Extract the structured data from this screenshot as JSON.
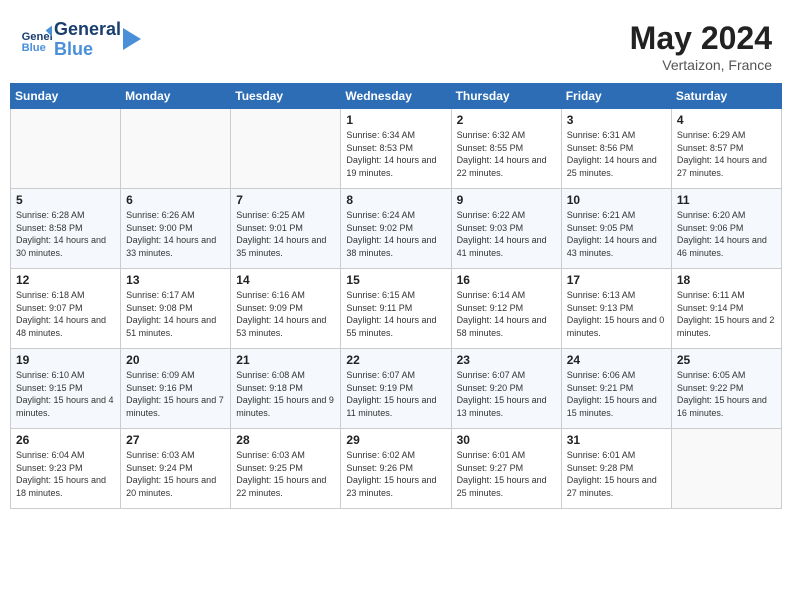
{
  "header": {
    "logo_line1": "General",
    "logo_line2": "Blue",
    "month_year": "May 2024",
    "location": "Vertaizon, France"
  },
  "days_of_week": [
    "Sunday",
    "Monday",
    "Tuesday",
    "Wednesday",
    "Thursday",
    "Friday",
    "Saturday"
  ],
  "weeks": [
    [
      {
        "day": "",
        "sunrise": "",
        "sunset": "",
        "daylight": ""
      },
      {
        "day": "",
        "sunrise": "",
        "sunset": "",
        "daylight": ""
      },
      {
        "day": "",
        "sunrise": "",
        "sunset": "",
        "daylight": ""
      },
      {
        "day": "1",
        "sunrise": "Sunrise: 6:34 AM",
        "sunset": "Sunset: 8:53 PM",
        "daylight": "Daylight: 14 hours and 19 minutes."
      },
      {
        "day": "2",
        "sunrise": "Sunrise: 6:32 AM",
        "sunset": "Sunset: 8:55 PM",
        "daylight": "Daylight: 14 hours and 22 minutes."
      },
      {
        "day": "3",
        "sunrise": "Sunrise: 6:31 AM",
        "sunset": "Sunset: 8:56 PM",
        "daylight": "Daylight: 14 hours and 25 minutes."
      },
      {
        "day": "4",
        "sunrise": "Sunrise: 6:29 AM",
        "sunset": "Sunset: 8:57 PM",
        "daylight": "Daylight: 14 hours and 27 minutes."
      }
    ],
    [
      {
        "day": "5",
        "sunrise": "Sunrise: 6:28 AM",
        "sunset": "Sunset: 8:58 PM",
        "daylight": "Daylight: 14 hours and 30 minutes."
      },
      {
        "day": "6",
        "sunrise": "Sunrise: 6:26 AM",
        "sunset": "Sunset: 9:00 PM",
        "daylight": "Daylight: 14 hours and 33 minutes."
      },
      {
        "day": "7",
        "sunrise": "Sunrise: 6:25 AM",
        "sunset": "Sunset: 9:01 PM",
        "daylight": "Daylight: 14 hours and 35 minutes."
      },
      {
        "day": "8",
        "sunrise": "Sunrise: 6:24 AM",
        "sunset": "Sunset: 9:02 PM",
        "daylight": "Daylight: 14 hours and 38 minutes."
      },
      {
        "day": "9",
        "sunrise": "Sunrise: 6:22 AM",
        "sunset": "Sunset: 9:03 PM",
        "daylight": "Daylight: 14 hours and 41 minutes."
      },
      {
        "day": "10",
        "sunrise": "Sunrise: 6:21 AM",
        "sunset": "Sunset: 9:05 PM",
        "daylight": "Daylight: 14 hours and 43 minutes."
      },
      {
        "day": "11",
        "sunrise": "Sunrise: 6:20 AM",
        "sunset": "Sunset: 9:06 PM",
        "daylight": "Daylight: 14 hours and 46 minutes."
      }
    ],
    [
      {
        "day": "12",
        "sunrise": "Sunrise: 6:18 AM",
        "sunset": "Sunset: 9:07 PM",
        "daylight": "Daylight: 14 hours and 48 minutes."
      },
      {
        "day": "13",
        "sunrise": "Sunrise: 6:17 AM",
        "sunset": "Sunset: 9:08 PM",
        "daylight": "Daylight: 14 hours and 51 minutes."
      },
      {
        "day": "14",
        "sunrise": "Sunrise: 6:16 AM",
        "sunset": "Sunset: 9:09 PM",
        "daylight": "Daylight: 14 hours and 53 minutes."
      },
      {
        "day": "15",
        "sunrise": "Sunrise: 6:15 AM",
        "sunset": "Sunset: 9:11 PM",
        "daylight": "Daylight: 14 hours and 55 minutes."
      },
      {
        "day": "16",
        "sunrise": "Sunrise: 6:14 AM",
        "sunset": "Sunset: 9:12 PM",
        "daylight": "Daylight: 14 hours and 58 minutes."
      },
      {
        "day": "17",
        "sunrise": "Sunrise: 6:13 AM",
        "sunset": "Sunset: 9:13 PM",
        "daylight": "Daylight: 15 hours and 0 minutes."
      },
      {
        "day": "18",
        "sunrise": "Sunrise: 6:11 AM",
        "sunset": "Sunset: 9:14 PM",
        "daylight": "Daylight: 15 hours and 2 minutes."
      }
    ],
    [
      {
        "day": "19",
        "sunrise": "Sunrise: 6:10 AM",
        "sunset": "Sunset: 9:15 PM",
        "daylight": "Daylight: 15 hours and 4 minutes."
      },
      {
        "day": "20",
        "sunrise": "Sunrise: 6:09 AM",
        "sunset": "Sunset: 9:16 PM",
        "daylight": "Daylight: 15 hours and 7 minutes."
      },
      {
        "day": "21",
        "sunrise": "Sunrise: 6:08 AM",
        "sunset": "Sunset: 9:18 PM",
        "daylight": "Daylight: 15 hours and 9 minutes."
      },
      {
        "day": "22",
        "sunrise": "Sunrise: 6:07 AM",
        "sunset": "Sunset: 9:19 PM",
        "daylight": "Daylight: 15 hours and 11 minutes."
      },
      {
        "day": "23",
        "sunrise": "Sunrise: 6:07 AM",
        "sunset": "Sunset: 9:20 PM",
        "daylight": "Daylight: 15 hours and 13 minutes."
      },
      {
        "day": "24",
        "sunrise": "Sunrise: 6:06 AM",
        "sunset": "Sunset: 9:21 PM",
        "daylight": "Daylight: 15 hours and 15 minutes."
      },
      {
        "day": "25",
        "sunrise": "Sunrise: 6:05 AM",
        "sunset": "Sunset: 9:22 PM",
        "daylight": "Daylight: 15 hours and 16 minutes."
      }
    ],
    [
      {
        "day": "26",
        "sunrise": "Sunrise: 6:04 AM",
        "sunset": "Sunset: 9:23 PM",
        "daylight": "Daylight: 15 hours and 18 minutes."
      },
      {
        "day": "27",
        "sunrise": "Sunrise: 6:03 AM",
        "sunset": "Sunset: 9:24 PM",
        "daylight": "Daylight: 15 hours and 20 minutes."
      },
      {
        "day": "28",
        "sunrise": "Sunrise: 6:03 AM",
        "sunset": "Sunset: 9:25 PM",
        "daylight": "Daylight: 15 hours and 22 minutes."
      },
      {
        "day": "29",
        "sunrise": "Sunrise: 6:02 AM",
        "sunset": "Sunset: 9:26 PM",
        "daylight": "Daylight: 15 hours and 23 minutes."
      },
      {
        "day": "30",
        "sunrise": "Sunrise: 6:01 AM",
        "sunset": "Sunset: 9:27 PM",
        "daylight": "Daylight: 15 hours and 25 minutes."
      },
      {
        "day": "31",
        "sunrise": "Sunrise: 6:01 AM",
        "sunset": "Sunset: 9:28 PM",
        "daylight": "Daylight: 15 hours and 27 minutes."
      },
      {
        "day": "",
        "sunrise": "",
        "sunset": "",
        "daylight": ""
      }
    ]
  ]
}
